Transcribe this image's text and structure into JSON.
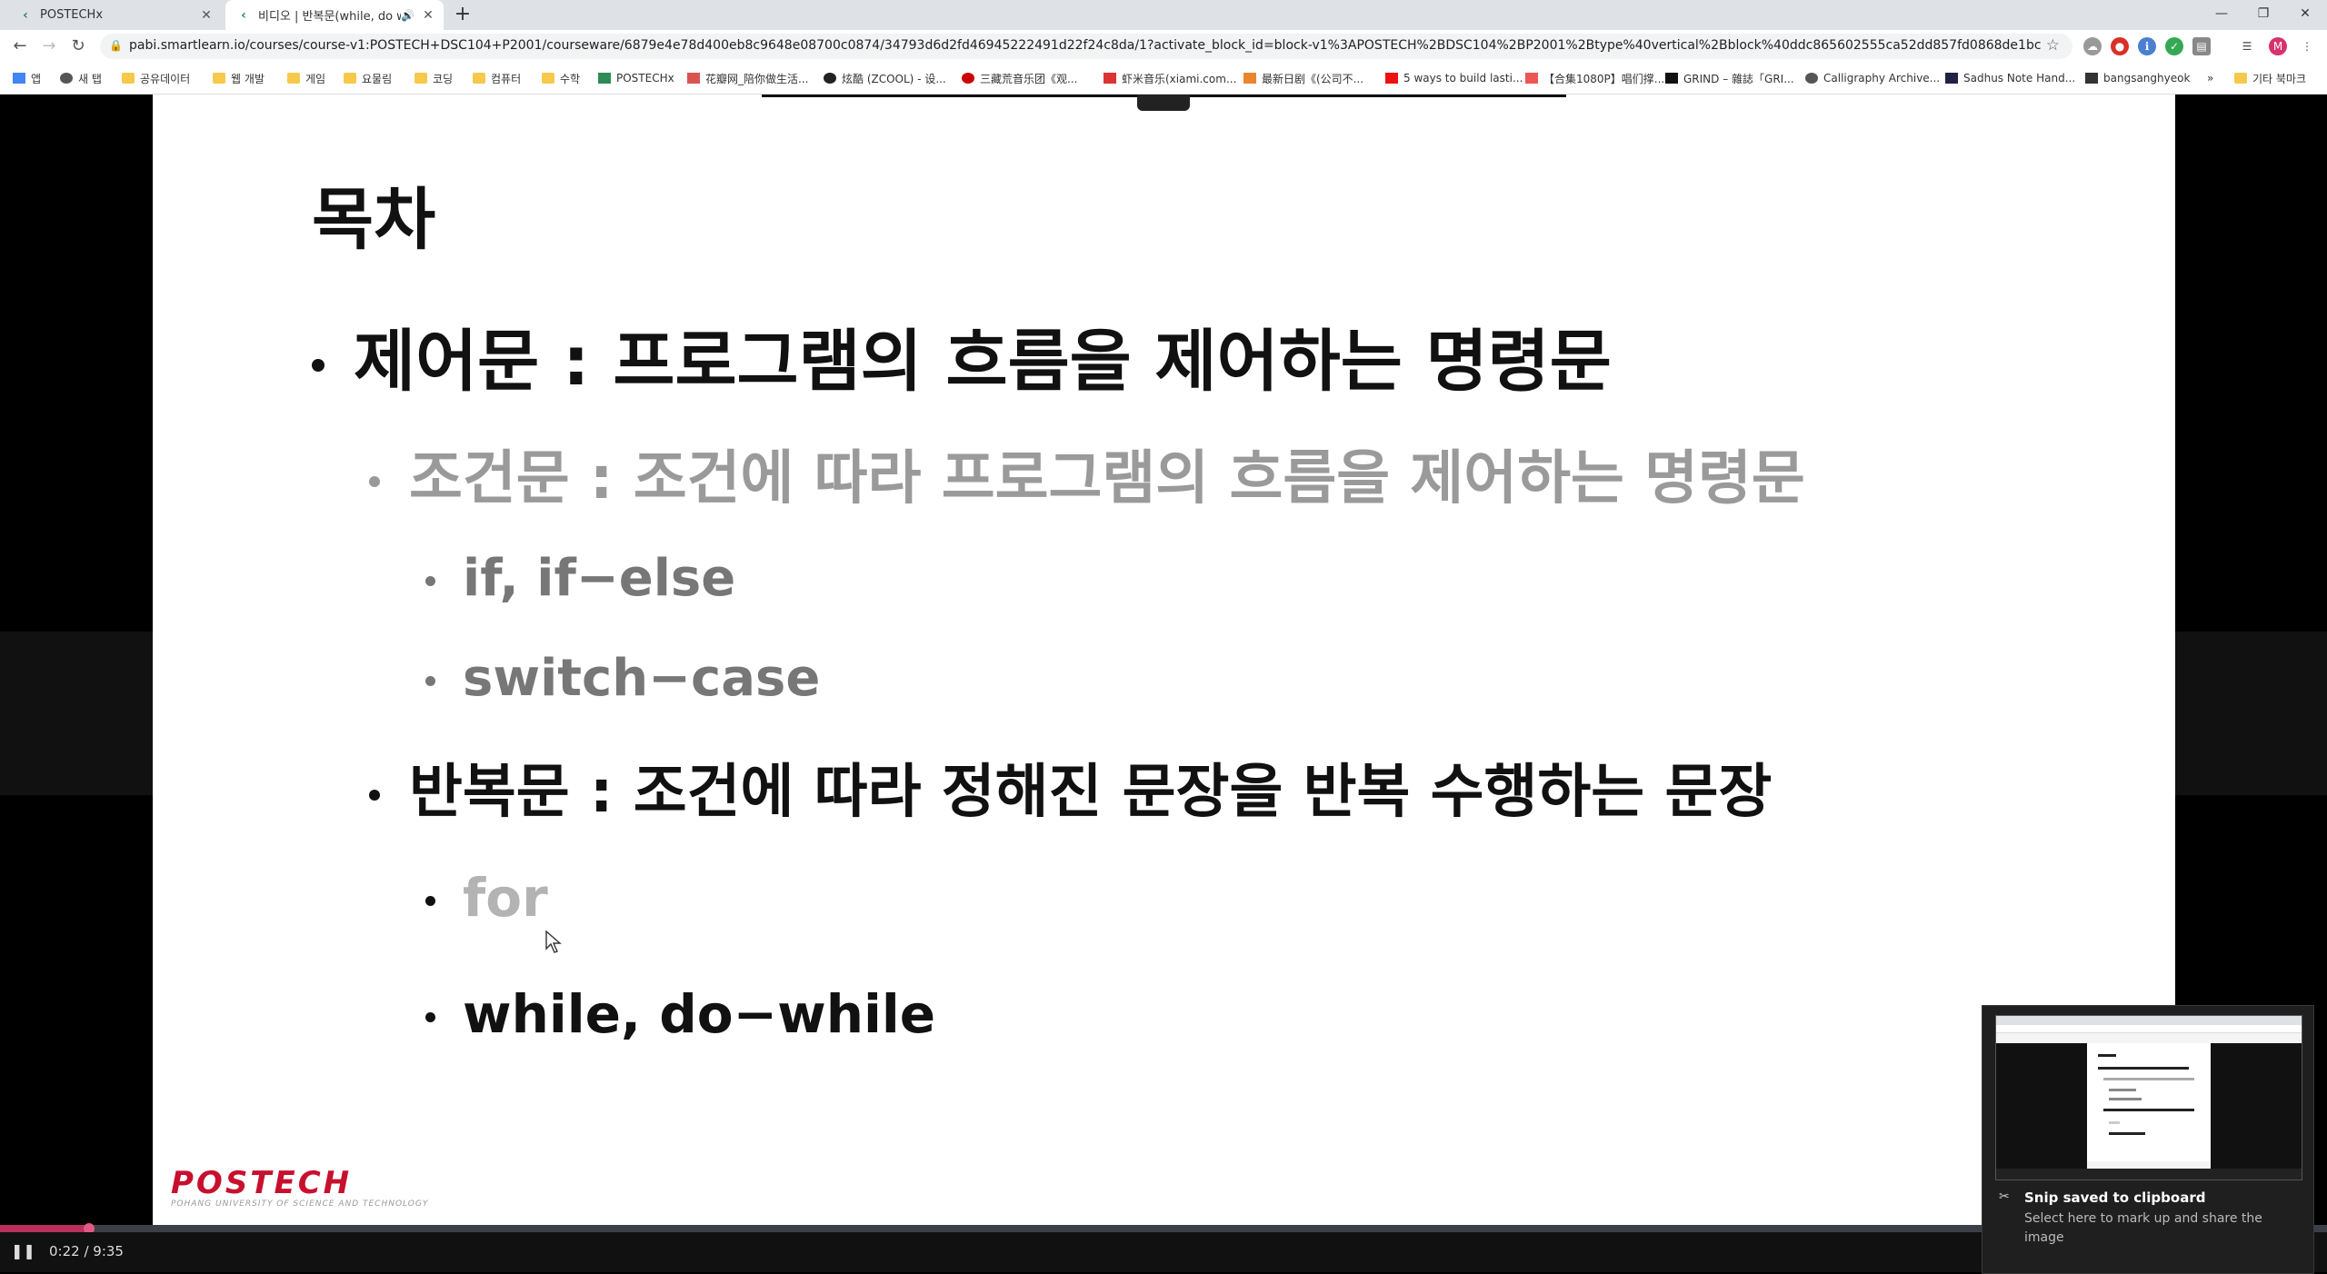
{
  "tabs": [
    {
      "title": "POSTECHx"
    },
    {
      "title": "비디오 | 반복문(while, do w"
    }
  ],
  "url": "pabi.smartlearn.io/courses/course-v1:POSTECH+DSC104+P2001/courseware/6879e4e78d400eb8c9648e08700c0874/34793d6d2fd46945222491d22f24c8da/1?activate_block_id=block-v1%3APOSTECH%2BDSC104%2BP2001%2Btype%40vertical%2Bblock%40ddc865602555ca52dd857fd0868de1bc",
  "bookmarks": [
    "앱",
    "새 탭",
    "공유데이터",
    "웹 개발",
    "게임",
    "요물림",
    "코딩",
    "컴퓨터",
    "수학",
    "POSTECHx",
    "花瓣网_陪你做生活...",
    "炫酷 (ZCOOL) - 设...",
    "三藏荒音乐团《观...",
    "虾米音乐(xiami.com...",
    "最新日剧《(公司不...",
    "5 ways to build lasti...",
    "【合集1080P】唱们撑...",
    "GRIND – 雜誌「GRI...",
    "Calligraphy Archive...",
    "Sadhus Note Hand...",
    "bangsanghyeok",
    "기타 북마크"
  ],
  "profile_initial": "M",
  "slide": {
    "title": "목차",
    "items": [
      "제어문 : 프로그램의 흐름을 제어하는 명령문",
      "조건문 : 조건에 따라 프로그램의 흐름을 제어하는 명령문",
      "if, if−else",
      "switch−case",
      "반복문 : 조건에 따라 정해진 문장을 반복 수행하는 문장",
      "for",
      "while, do−while"
    ],
    "logo": "POSTECH",
    "logo_sub": "POHANG UNIVERSITY OF SCIENCE AND TECHNOLOGY"
  },
  "player": {
    "time": "0:22 / 9:35",
    "progress_fraction": 0.0383
  },
  "notification": {
    "title": "Snip saved to clipboard",
    "body": "Select here to mark up and share the image"
  }
}
